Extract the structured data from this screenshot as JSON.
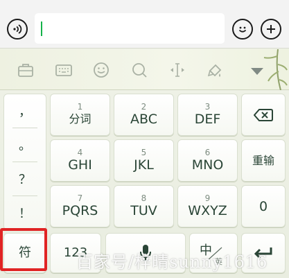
{
  "input_bar": {
    "voice_icon": "voice-icon",
    "text_value": "",
    "emoji_icon": "emoji-icon",
    "add_icon": "plus-icon"
  },
  "toolbar": {
    "items": [
      "briefcase-icon",
      "keyboard-icon",
      "smiley-icon",
      "search-icon",
      "cursor-icon",
      "paint-icon",
      "collapse-arrow-icon"
    ]
  },
  "keyboard": {
    "punctuation": [
      "，",
      "。",
      "？",
      "！"
    ],
    "keys": {
      "k1": {
        "num": "1",
        "label": "分词"
      },
      "k2": {
        "num": "2",
        "label": "ABC"
      },
      "k3": {
        "num": "3",
        "label": "DEF"
      },
      "k4": {
        "num": "4",
        "label": "GHI"
      },
      "k5": {
        "num": "5",
        "label": "JKL"
      },
      "k6": {
        "num": "6",
        "label": "MNO"
      },
      "k7": {
        "num": "7",
        "label": "PQRS"
      },
      "k8": {
        "num": "8",
        "label": "TUV"
      },
      "k9": {
        "num": "9",
        "label": "WXYZ"
      },
      "k0": {
        "label": "0"
      }
    },
    "rewrite_label": "重输",
    "symbol_label": "符",
    "numeric_label": "123",
    "lang_main": "中",
    "lang_sub": "英"
  },
  "watermark": "百家号/梓晴sunny1616",
  "colors": {
    "highlight": "#e02424",
    "caret": "#14b24a",
    "key_text": "#2a4536"
  }
}
